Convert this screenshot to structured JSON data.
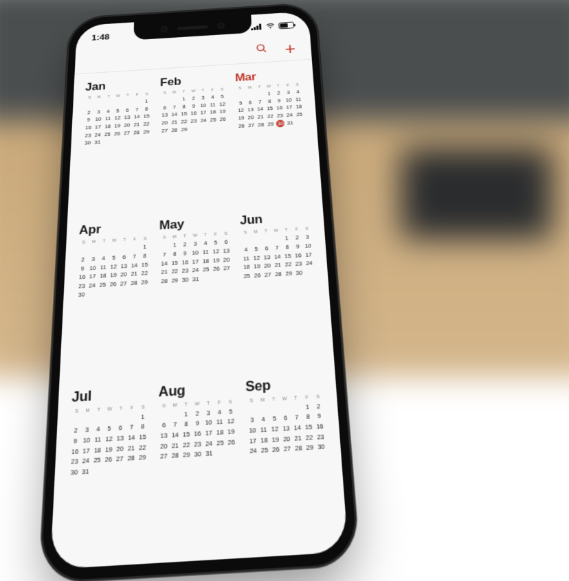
{
  "status": {
    "time": "1:48"
  },
  "toolbar": {
    "search_icon": "search",
    "add_label": "+"
  },
  "dow": [
    "S",
    "M",
    "T",
    "W",
    "T",
    "F",
    "S"
  ],
  "today": {
    "month": "Mar",
    "day": 30
  },
  "months": [
    {
      "name": "Jan",
      "start": 6,
      "len": 31
    },
    {
      "name": "Feb",
      "start": 2,
      "len": 29
    },
    {
      "name": "Mar",
      "start": 3,
      "len": 31
    },
    {
      "name": "Apr",
      "start": 6,
      "len": 30
    },
    {
      "name": "May",
      "start": 1,
      "len": 31
    },
    {
      "name": "Jun",
      "start": 4,
      "len": 30
    },
    {
      "name": "Jul",
      "start": 6,
      "len": 31
    },
    {
      "name": "Aug",
      "start": 2,
      "len": 31
    },
    {
      "name": "Sep",
      "start": 5,
      "len": 30
    }
  ],
  "colors": {
    "accent": "#c0392b"
  }
}
